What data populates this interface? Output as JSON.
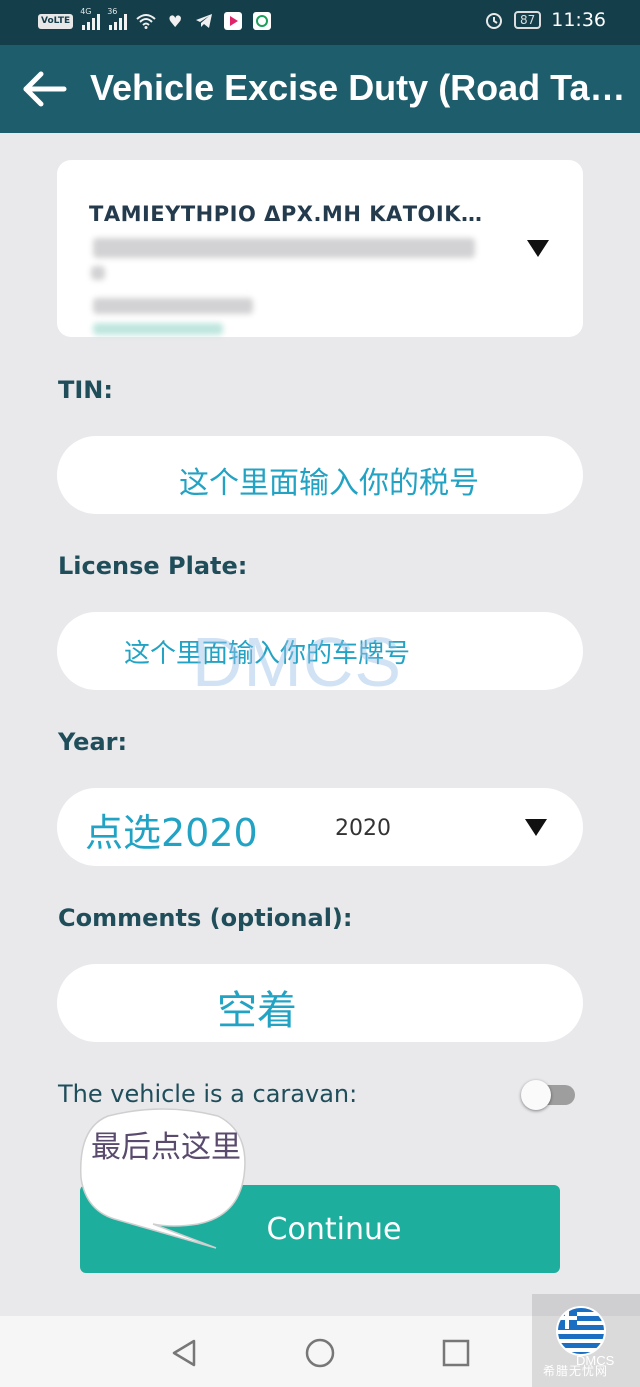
{
  "status_bar": {
    "volte": "VoLTE",
    "signal1_tag": "4G",
    "signal2_tag": "36",
    "battery": "87",
    "time": "11:36"
  },
  "app_bar": {
    "title": "Vehicle Excise Duty (Road Ta…",
    "back_icon": "arrow-left-icon"
  },
  "account": {
    "title": "ΤΑΜΙΕΥΤΗΡΙΟ ΔΡΧ.ΜΗ ΚΑΤΟΙΚ…"
  },
  "form": {
    "tin_label": "TIN:",
    "tin_hint": "这个里面输入你的税号",
    "plate_label": "License Plate:",
    "plate_hint": "这个里面输入你的车牌号",
    "year_label": "Year:",
    "year_hint": "点选2020",
    "year_value": "2020",
    "comments_label": "Comments (optional):",
    "comments_hint": "空着",
    "caravan_label": "The vehicle is a caravan:",
    "caravan_on": false
  },
  "watermark": "DMCS",
  "continue_label": "Continue",
  "bubble_text": "最后点这里",
  "nav": [
    "back-triangle-icon",
    "home-circle-icon",
    "recents-square-icon"
  ],
  "logo_caption": "希腊无忧网",
  "logo_text": "DMCS",
  "colors": {
    "status_bar": "#143e4a",
    "app_bar": "#1e5d6b",
    "accent": "#1eae9e",
    "hint": "#23a3c4",
    "label": "#1f4e5a"
  }
}
